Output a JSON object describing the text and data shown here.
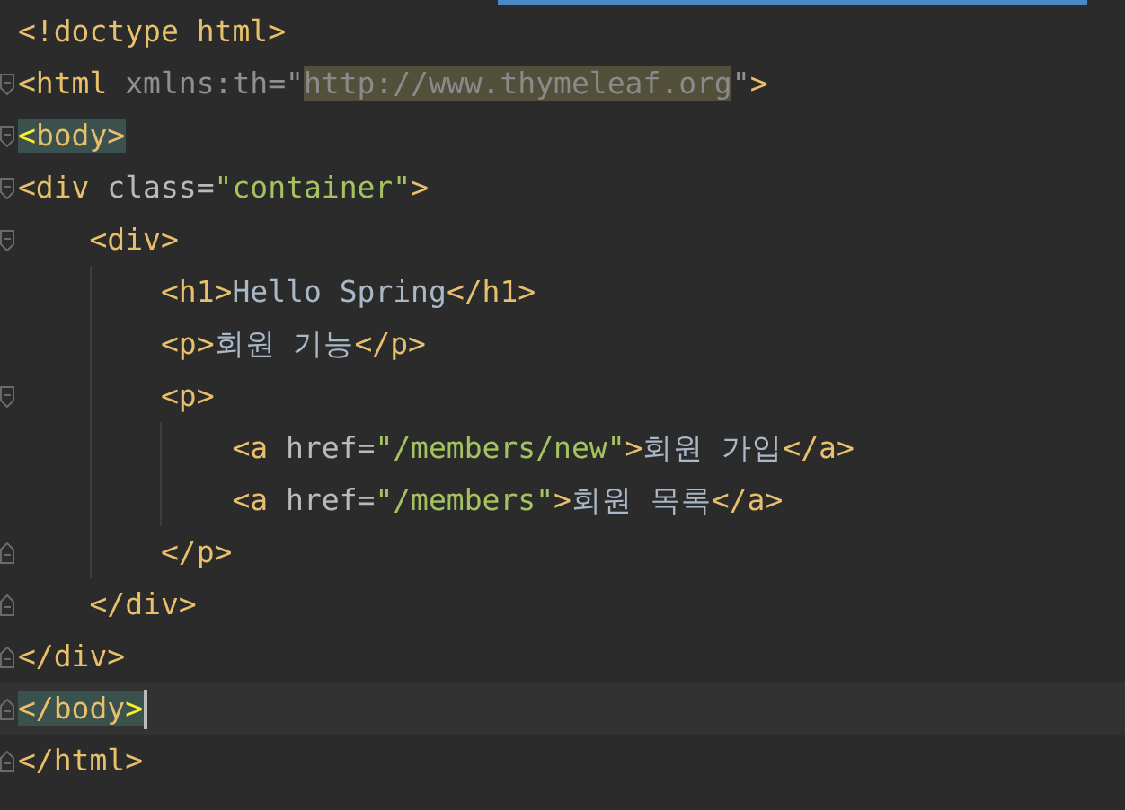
{
  "editor": {
    "lines": [
      {
        "current": false,
        "tokens": [
          {
            "kind": "tag",
            "text": "<!doctype html>",
            "matched": false
          }
        ]
      },
      {
        "kind": "open",
        "current": false,
        "tokens": [
          {
            "kind": "tag",
            "text": "<html ",
            "matched": false
          },
          {
            "kind": "ns",
            "text": "xmlns:th=\"",
            "matched": false
          },
          {
            "kind": "url",
            "text": "http://www.thymeleaf.org",
            "matched": false
          },
          {
            "kind": "ns",
            "text": "\"",
            "matched": false
          },
          {
            "kind": "tag",
            "text": ">",
            "matched": false
          }
        ]
      },
      {
        "kind": "open",
        "current": false,
        "tokens": [
          {
            "kind": "brace",
            "text": "<",
            "matched": true
          },
          {
            "kind": "tag",
            "text": "body>",
            "matched": true
          }
        ]
      },
      {
        "kind": "open",
        "current": false,
        "tokens": [
          {
            "kind": "tag",
            "text": "<div ",
            "matched": false
          },
          {
            "kind": "attr",
            "text": "class=",
            "matched": false
          },
          {
            "kind": "string",
            "text": "\"container\"",
            "matched": false
          },
          {
            "kind": "tag",
            "text": ">",
            "matched": false
          }
        ],
        "children": [
          {
            "kind": "open",
            "current": false,
            "tokens": [
              {
                "kind": "tag",
                "text": "<div>",
                "matched": false
              }
            ],
            "children": [
              {
                "current": false,
                "tokens": [
                  {
                    "kind": "tag",
                    "text": "<h1>",
                    "matched": false
                  },
                  {
                    "kind": "text",
                    "text": "Hello Spring",
                    "matched": false
                  },
                  {
                    "kind": "tag",
                    "text": "</h1>",
                    "matched": false
                  }
                ]
              },
              {
                "current": false,
                "tokens": [
                  {
                    "kind": "tag",
                    "text": "<p>",
                    "matched": false
                  },
                  {
                    "kind": "text",
                    "text": "회원 기능",
                    "matched": false
                  },
                  {
                    "kind": "tag",
                    "text": "</p>",
                    "matched": false
                  }
                ]
              },
              {
                "kind": "open",
                "current": false,
                "tokens": [
                  {
                    "kind": "tag",
                    "text": "<p>",
                    "matched": false
                  }
                ],
                "children": [
                  {
                    "current": false,
                    "tokens": [
                      {
                        "kind": "tag",
                        "text": "<a ",
                        "matched": false
                      },
                      {
                        "kind": "attr",
                        "text": "href=",
                        "matched": false
                      },
                      {
                        "kind": "string",
                        "text": "\"/members/new\"",
                        "matched": false
                      },
                      {
                        "kind": "tag",
                        "text": ">",
                        "matched": false
                      },
                      {
                        "kind": "text",
                        "text": "회원 가입",
                        "matched": false
                      },
                      {
                        "kind": "tag",
                        "text": "</a>",
                        "matched": false
                      }
                    ]
                  },
                  {
                    "current": false,
                    "tokens": [
                      {
                        "kind": "tag",
                        "text": "<a ",
                        "matched": false
                      },
                      {
                        "kind": "attr",
                        "text": "href=",
                        "matched": false
                      },
                      {
                        "kind": "string",
                        "text": "\"/members\"",
                        "matched": false
                      },
                      {
                        "kind": "tag",
                        "text": ">",
                        "matched": false
                      },
                      {
                        "kind": "text",
                        "text": "회원 목록",
                        "matched": false
                      },
                      {
                        "kind": "tag",
                        "text": "</a>",
                        "matched": false
                      }
                    ]
                  }
                ]
              },
              {
                "kind": "close",
                "current": false,
                "tokens": [
                  {
                    "kind": "tag",
                    "text": "</p>",
                    "matched": false
                  }
                ]
              }
            ]
          },
          {
            "kind": "close",
            "current": false,
            "tokens": [
              {
                "kind": "tag",
                "text": "</div>",
                "matched": false
              }
            ]
          }
        ]
      },
      {
        "kind": "close",
        "current": false,
        "tokens": [
          {
            "kind": "tag",
            "text": "</div>",
            "matched": false
          }
        ]
      },
      {
        "kind": "close",
        "current": true,
        "tokens": [
          {
            "kind": "tag",
            "text": "</body",
            "matched": true
          },
          {
            "kind": "brace",
            "text": ">",
            "matched": true
          }
        ]
      },
      {
        "kind": "close",
        "current": false,
        "tokens": [
          {
            "kind": "tag",
            "text": "</html>",
            "matched": false
          }
        ]
      }
    ]
  }
}
